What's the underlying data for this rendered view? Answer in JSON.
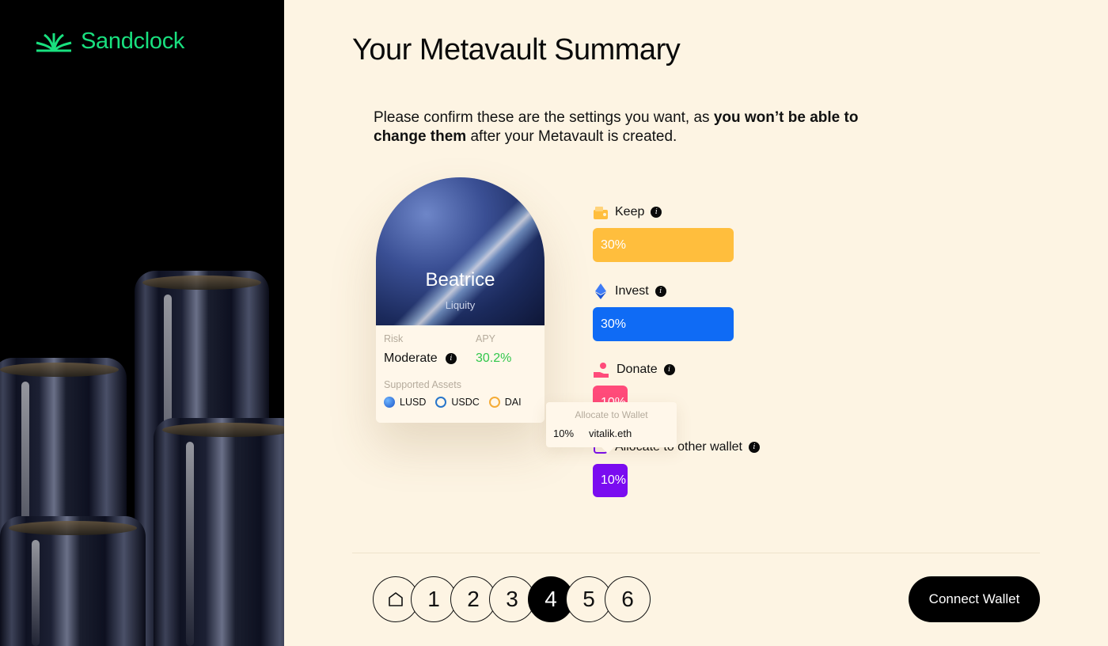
{
  "brand": {
    "name": "Sandclock",
    "color": "#19e07f"
  },
  "page": {
    "title": "Your Metavault Summary",
    "intro_part1": "Please confirm these are the settings you want, as ",
    "intro_bold1": "you won’t be able to change them",
    "intro_part2": " after your Metavault is created."
  },
  "vault": {
    "name": "Beatrice",
    "protocol": "Liquity",
    "risk_label": "Risk",
    "risk_value": "Moderate",
    "apy_label": "APY",
    "apy_value": "30.2%",
    "assets_label": "Supported Assets",
    "assets": [
      {
        "name": "LUSD",
        "icon": "lusd-icon",
        "color": "#2a7de1"
      },
      {
        "name": "USDC",
        "icon": "usdc-icon",
        "color": "#2775ca"
      },
      {
        "name": "DAI",
        "icon": "dai-icon",
        "color": "#f5ac37"
      }
    ]
  },
  "allocations": [
    {
      "label": "Keep",
      "value": "30%",
      "percent": 30,
      "color": "#ffbe3d",
      "icon": "wallet-icon"
    },
    {
      "label": "Invest",
      "value": "30%",
      "percent": 30,
      "color": "#0f6bf5",
      "icon": "ethereum-icon"
    },
    {
      "label": "Donate",
      "value": "10%",
      "percent": 10,
      "color": "#ff4b7a",
      "icon": "donate-hand-icon"
    },
    {
      "label": "Allocate to other wallet",
      "value": "10%",
      "percent": 10,
      "color": "#7a0cf0",
      "icon": "wallet-allocate-icon"
    }
  ],
  "tooltip": {
    "title": "Allocate to Wallet",
    "pct": "10%",
    "wallet": "vitalik.eth"
  },
  "stepper": {
    "steps": [
      "1",
      "2",
      "3",
      "4",
      "5",
      "6"
    ],
    "active": "4",
    "home_icon": "home-icon"
  },
  "actions": {
    "connect_label": "Connect Wallet"
  }
}
